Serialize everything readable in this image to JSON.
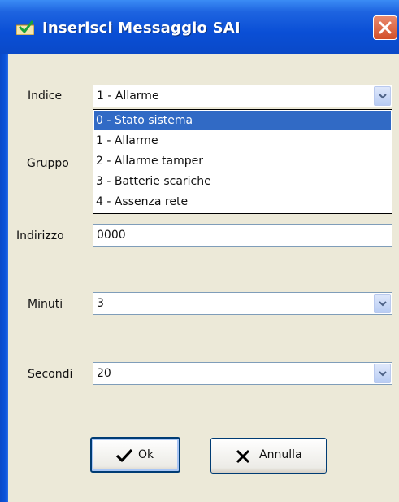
{
  "window": {
    "title": "Inserisci Messaggio SAI",
    "icon": "app-check-icon",
    "close_icon": "close-icon"
  },
  "form": {
    "indice": {
      "label": "Indice",
      "value": "1 - Allarme"
    },
    "gruppo": {
      "label": "Gruppo"
    },
    "indirizzo": {
      "label": "Indirizzo",
      "value": "0000"
    },
    "minuti": {
      "label": "Minuti",
      "value": "3"
    },
    "secondi": {
      "label": "Secondi",
      "value": "20"
    }
  },
  "dropdown": {
    "options": [
      "0 - Stato sistema",
      "1 - Allarme",
      "2 - Allarme tamper",
      "3 - Batterie scariche",
      "4 - Assenza rete"
    ],
    "highlighted_index": 0
  },
  "buttons": {
    "ok": {
      "label": "Ok",
      "icon": "checkmark-icon"
    },
    "cancel": {
      "label": "Annulla",
      "icon": "x-icon"
    }
  },
  "colors": {
    "titlebar": "#0a4fd6",
    "dialog_bg": "#ece9d8",
    "selection": "#316ac5",
    "close_button": "#d3502a"
  }
}
